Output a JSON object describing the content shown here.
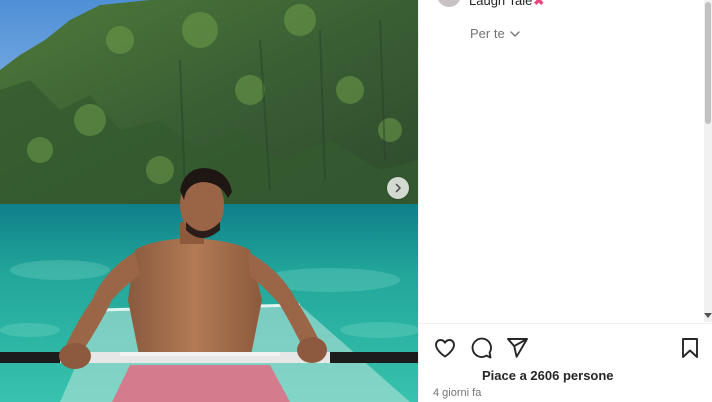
{
  "post": {
    "comment_text": "Laugh Tale",
    "comment_emoji": "✖",
    "filter_label": "Per te",
    "likes_text": "Piace a 2606 persone",
    "date_text": "4 giorni fa"
  },
  "icons": {
    "like": "heart-icon",
    "comment": "comment-icon",
    "share": "share-icon",
    "save": "bookmark-icon",
    "next": "chevron-right-icon"
  },
  "colors": {
    "sea": "#2aa99b",
    "cliff": "#3f6a36",
    "sky": "#6da8e0",
    "text": "#262626",
    "muted": "#737373"
  }
}
